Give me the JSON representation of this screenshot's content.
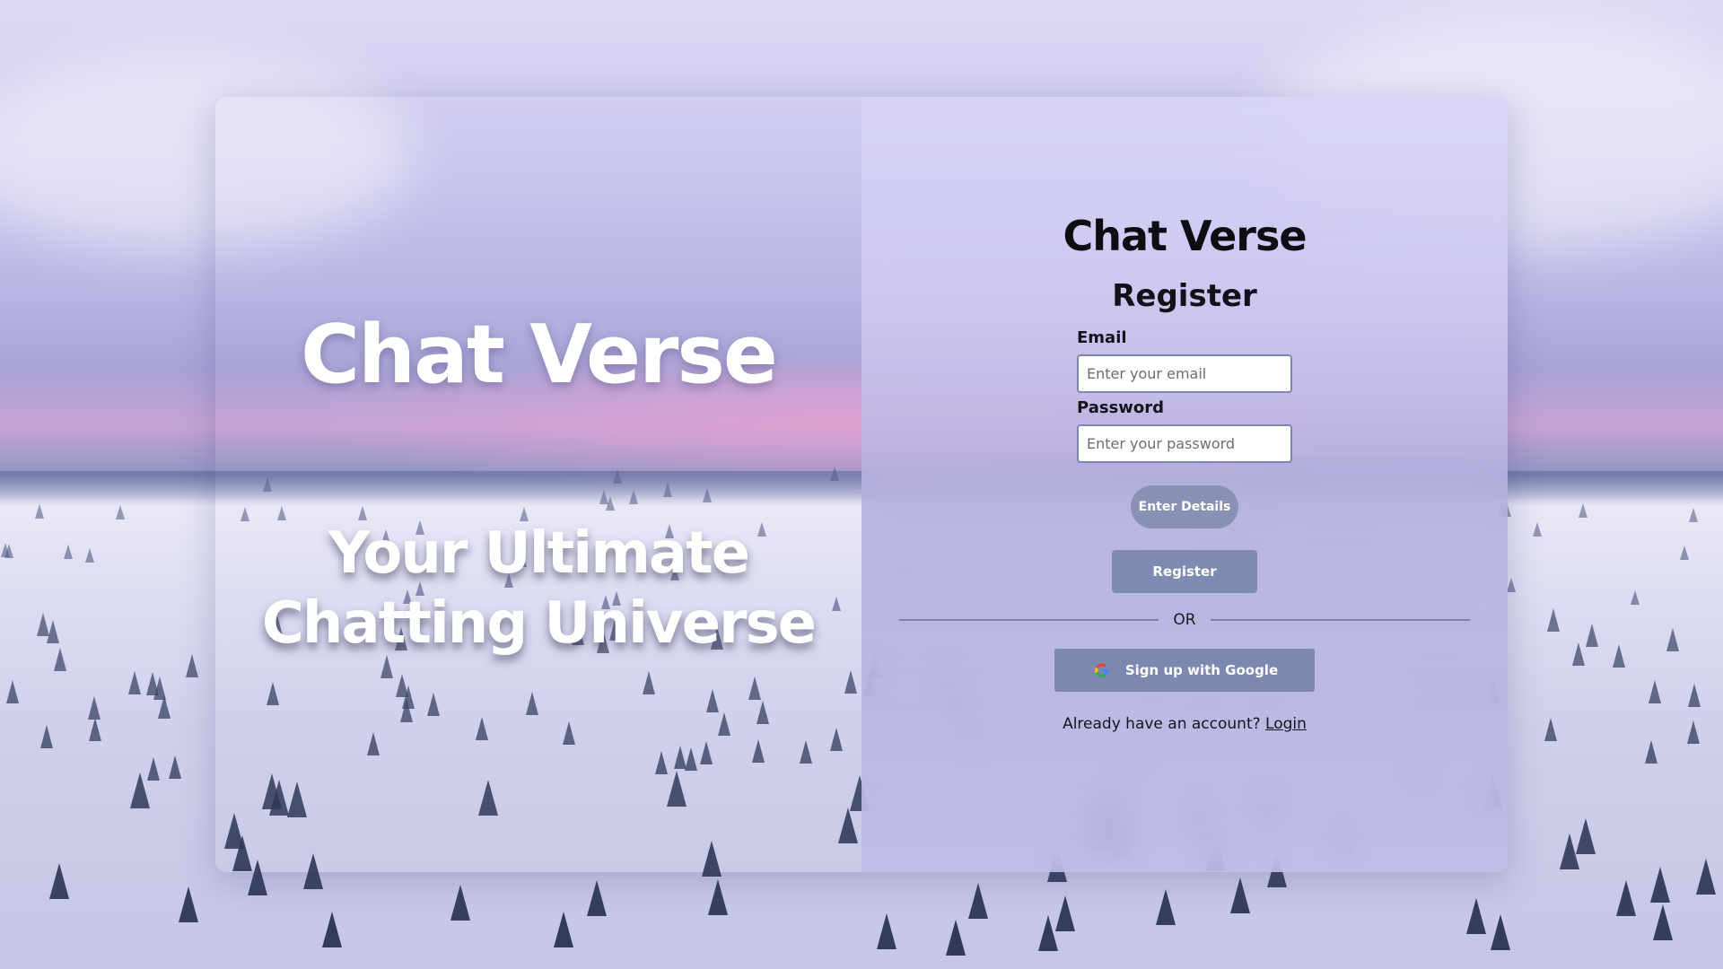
{
  "hero": {
    "title": "Chat Verse",
    "tagline_line1": "Your Ultimate",
    "tagline_line2": "Chatting Universe"
  },
  "form": {
    "brand": "Chat Verse",
    "heading": "Register",
    "email": {
      "label": "Email",
      "placeholder": "Enter your email",
      "value": ""
    },
    "password": {
      "label": "Password",
      "placeholder": "Enter your password",
      "value": ""
    },
    "enter_details_label": "Enter Details",
    "register_label": "Register",
    "divider_text": "OR",
    "google_label": "Sign up with Google",
    "google_icon": "google-g-icon",
    "account_prompt": "Already have an account?",
    "login_link": "Login"
  },
  "theme": {
    "button_color": "#7d8ab1",
    "panel_tint": "#d7d4f6",
    "text_color": "#0d0d14"
  }
}
